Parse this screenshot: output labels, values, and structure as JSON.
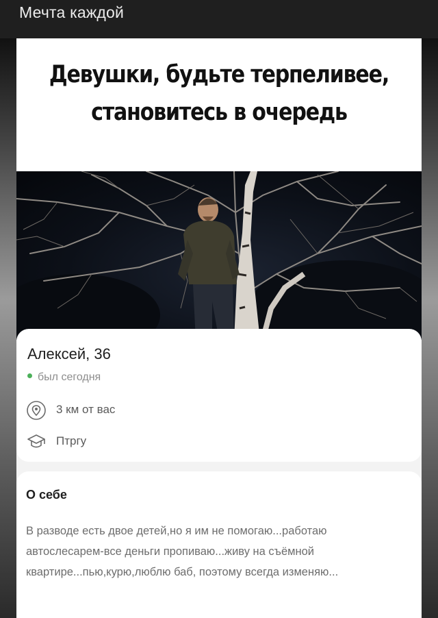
{
  "header": {
    "title": "Мечта каждой"
  },
  "post": {
    "caption": "Девушки, будьте терпеливее, становитесь в очередь"
  },
  "profile": {
    "name_age": "Алексей, 36",
    "status": "был сегодня",
    "distance": "3 км от вас",
    "education": "Птргу",
    "icons": {
      "distance": "location-pin-icon",
      "education": "graduation-cap-icon"
    },
    "colors": {
      "online_dot": "#4cb05a"
    }
  },
  "about": {
    "title": "О себе",
    "text": "В разводе есть двое детей,но я им не помогаю...работаю автослесарем-все деньги пропиваю...живу на съёмной квартире...пью,курю,люблю баб, поэтому всегда изменяю..."
  }
}
